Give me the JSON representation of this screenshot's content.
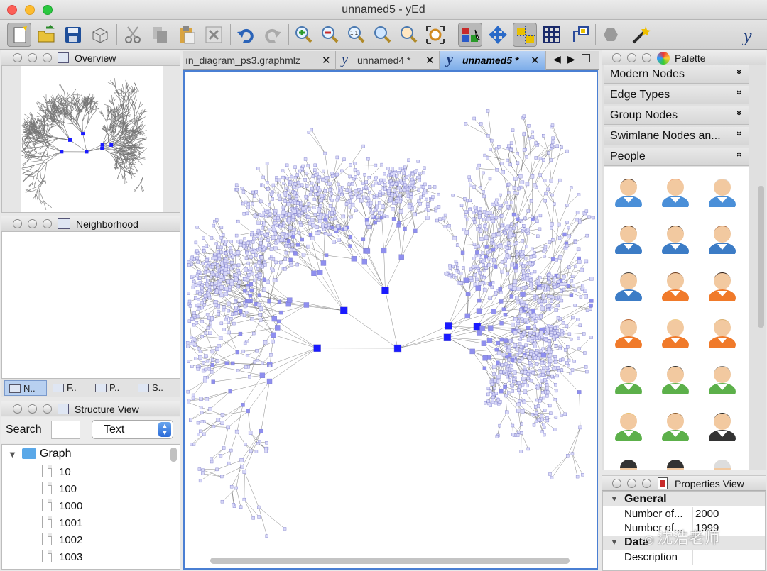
{
  "window": {
    "title": "unnamed5 - yEd"
  },
  "toolbar": {
    "icons": [
      "new-document-icon",
      "open-folder-icon",
      "save-icon",
      "print-icon",
      "cut-icon",
      "copy-icon",
      "paste-icon",
      "delete-icon",
      "undo-icon",
      "redo-icon",
      "zoom-in-icon",
      "zoom-out-icon",
      "zoom-actual-icon",
      "zoom-fit-icon",
      "zoom-area-icon",
      "fit-content-icon",
      "edit-mode-icon",
      "move-mode-icon",
      "snap-icon",
      "grid-icon",
      "port-icon",
      "group-icon",
      "magic-wand-icon",
      "yed-logo-icon"
    ]
  },
  "overview": {
    "title": "Overview"
  },
  "neighborhood": {
    "title": "Neighborhood"
  },
  "bottom_tabs": [
    "N..",
    "F..",
    "P..",
    "S.."
  ],
  "structure": {
    "title": "Structure View",
    "search_label": "Search",
    "search_value": "",
    "mode_value": "Text",
    "root": "Graph",
    "items": [
      "10",
      "100",
      "1000",
      "1001",
      "1002",
      "1003"
    ]
  },
  "tabs": [
    {
      "label": "ın_diagram_ps3.graphmlz",
      "active": false
    },
    {
      "label": "unnamed4 *",
      "active": false
    },
    {
      "label": "unnamed5 *",
      "active": true
    }
  ],
  "palette": {
    "title": "Palette",
    "sections": [
      {
        "label": "Modern Nodes",
        "chevron": "»"
      },
      {
        "label": "Edge Types",
        "chevron": "»"
      },
      {
        "label": "Group Nodes",
        "chevron": "»"
      },
      {
        "label": "Swimlane Nodes an...",
        "chevron": "»"
      },
      {
        "label": "People",
        "chevron": "«"
      }
    ],
    "people_rows": [
      [
        "#3f2a1e",
        "#f0a67a",
        "#dadada"
      ],
      [
        "#3a2418",
        "#2a1a10",
        "#a0603a"
      ],
      [
        "#3a3a3a",
        "#6b3a1c",
        "#221410"
      ],
      [
        "#b8693a",
        "#f0d090",
        "#d8b070"
      ],
      [
        "#2b2b2b",
        "#2b2b2b",
        "#808080"
      ],
      [
        "#e8c070",
        "#8a5a2a",
        "#202020"
      ]
    ],
    "people_colors": [
      "#4a8fd8",
      "#4a8fd8",
      "#4a8fd8",
      "#3c7cc6",
      "#3c7cc6",
      "#3c7cc6",
      "#3c7cc6",
      "#f07a2a",
      "#f07a2a",
      "#f07a2a",
      "#f07a2a",
      "#f07a2a",
      "#5cb04a",
      "#5cb04a",
      "#5cb04a",
      "#5cb04a",
      "#5cb04a",
      "#333333"
    ]
  },
  "properties": {
    "title": "Properties View",
    "sections": [
      {
        "label": "General",
        "rows": [
          {
            "name": "Number of...",
            "value": "2000"
          },
          {
            "name": "Number of...",
            "value": "1999"
          }
        ]
      },
      {
        "label": "Data",
        "rows": [
          {
            "name": "Description",
            "value": ""
          }
        ]
      }
    ]
  },
  "watermark": "沈浩老师",
  "colors": {
    "accent": "#4a7fd3",
    "node": "#8f8fef",
    "hub": "#1a1aff",
    "edge": "#555555"
  }
}
